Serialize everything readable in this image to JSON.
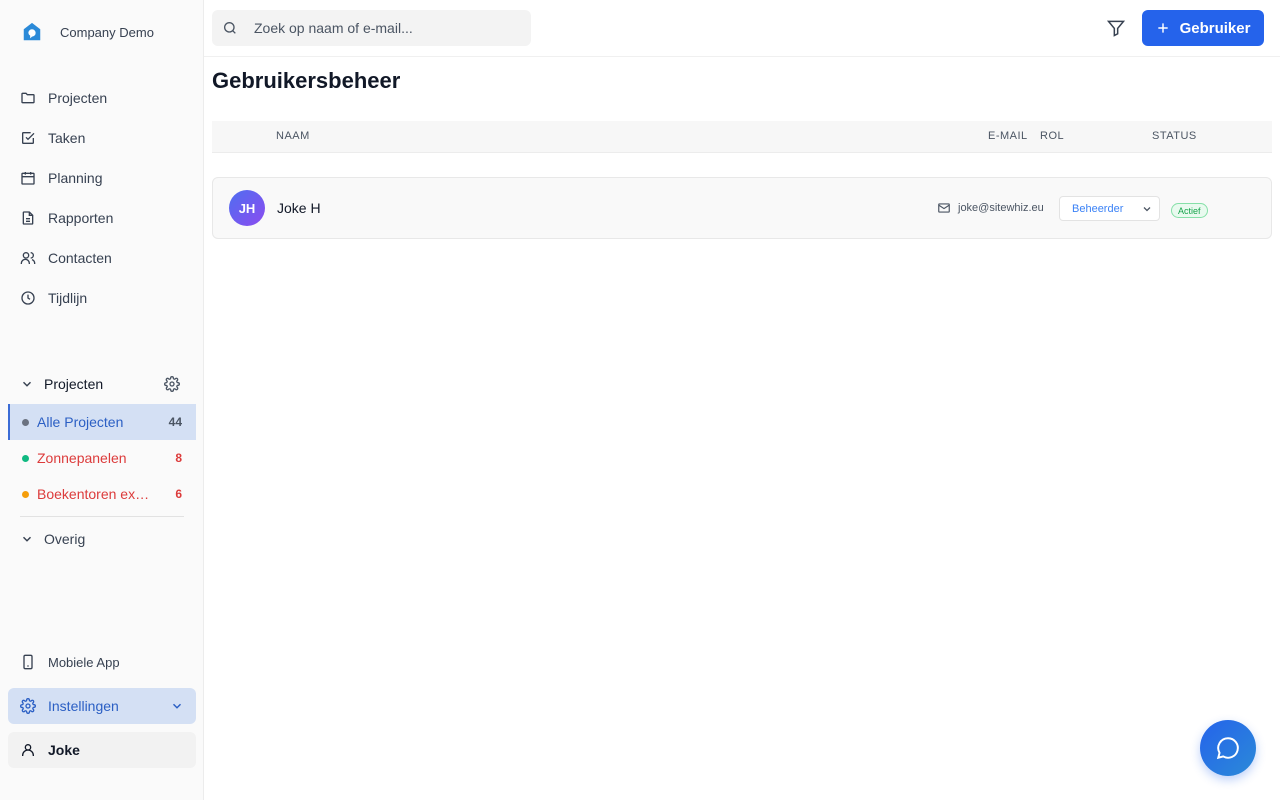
{
  "brand": {
    "name": "Company Demo"
  },
  "nav": [
    {
      "label": "Projecten",
      "icon": "folder-icon"
    },
    {
      "label": "Taken",
      "icon": "checkbox-icon"
    },
    {
      "label": "Planning",
      "icon": "calendar-icon"
    },
    {
      "label": "Rapporten",
      "icon": "file-text-icon"
    },
    {
      "label": "Contacten",
      "icon": "users-icon"
    },
    {
      "label": "Tijdlijn",
      "icon": "clock-icon"
    }
  ],
  "projects_section": {
    "title": "Projecten",
    "items": [
      {
        "label": "Alle Projecten",
        "count": "44",
        "dot_color": "#6b7280"
      },
      {
        "label": "Zonnepanelen",
        "count": "8",
        "dot_color": "#10b981"
      },
      {
        "label": "Boekentoren ex…",
        "count": "6",
        "dot_color": "#f59e0b"
      }
    ],
    "other_label": "Overig"
  },
  "bottom": {
    "mobile_label": "Mobiele App",
    "settings_label": "Instellingen",
    "user_label": "Joke"
  },
  "topbar": {
    "search_placeholder": "Zoek op naam of e-mail...",
    "add_button_label": "Gebruiker"
  },
  "page": {
    "title": "Gebruikersbeheer",
    "columns": {
      "name": "NAAM",
      "email": "E-MAIL",
      "role": "ROL",
      "status": "STATUS"
    },
    "users": [
      {
        "initials": "JH",
        "name": "Joke H",
        "email": "joke@sitewhiz.eu",
        "role": "Beheerder",
        "status": "Actief"
      }
    ]
  },
  "colors": {
    "accent": "#2563eb",
    "active_bg": "#d4e0f4",
    "status_green": "#16a34a",
    "danger_red": "#dc3b3b"
  }
}
